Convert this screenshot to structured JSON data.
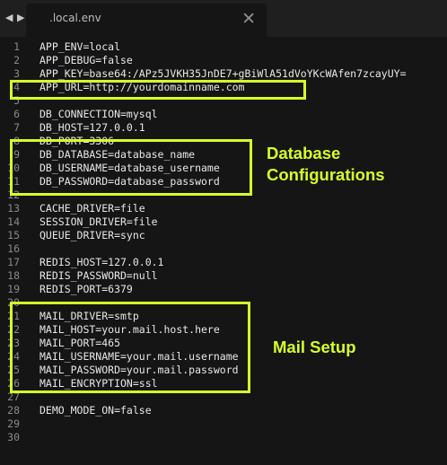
{
  "window": {
    "nav_back": "◀",
    "nav_forward": "▶",
    "tab_label": ".local.env",
    "tab_close": "✕"
  },
  "editor": {
    "lines": [
      {
        "n": "1",
        "text": "APP_ENV=local"
      },
      {
        "n": "2",
        "text": "APP_DEBUG=false"
      },
      {
        "n": "3",
        "text": "APP_KEY=base64:/APz5JVKH35JnDE7+gBiWlA51dVoYKcWAfen7zcayUY="
      },
      {
        "n": "4",
        "text": "APP_URL=http://yourdomainname.com"
      },
      {
        "n": "5",
        "text": ""
      },
      {
        "n": "6",
        "text": "DB_CONNECTION=mysql"
      },
      {
        "n": "7",
        "text": "DB_HOST=127.0.0.1"
      },
      {
        "n": "8",
        "text": "DB_PORT=3306"
      },
      {
        "n": "9",
        "text": "DB_DATABASE=database_name"
      },
      {
        "n": "10",
        "text": "DB_USERNAME=database_username"
      },
      {
        "n": "11",
        "text": "DB_PASSWORD=database_password"
      },
      {
        "n": "12",
        "text": ""
      },
      {
        "n": "13",
        "text": "CACHE_DRIVER=file"
      },
      {
        "n": "14",
        "text": "SESSION_DRIVER=file"
      },
      {
        "n": "15",
        "text": "QUEUE_DRIVER=sync"
      },
      {
        "n": "16",
        "text": ""
      },
      {
        "n": "17",
        "text": "REDIS_HOST=127.0.0.1"
      },
      {
        "n": "18",
        "text": "REDIS_PASSWORD=null"
      },
      {
        "n": "19",
        "text": "REDIS_PORT=6379"
      },
      {
        "n": "20",
        "text": ""
      },
      {
        "n": "21",
        "text": "MAIL_DRIVER=smtp"
      },
      {
        "n": "22",
        "text": "MAIL_HOST=your.mail.host.here"
      },
      {
        "n": "23",
        "text": "MAIL_PORT=465"
      },
      {
        "n": "24",
        "text": "MAIL_USERNAME=your.mail.username"
      },
      {
        "n": "25",
        "text": "MAIL_PASSWORD=your.mail.password"
      },
      {
        "n": "26",
        "text": "MAIL_ENCRYPTION=ssl"
      },
      {
        "n": "27",
        "text": ""
      },
      {
        "n": "28",
        "text": "DEMO_MODE_ON=false"
      },
      {
        "n": "29",
        "text": ""
      },
      {
        "n": "30",
        "text": ""
      }
    ]
  },
  "annotations": {
    "database_line1": "Database",
    "database_line2": "Configurations",
    "mail": "Mail Setup"
  },
  "colors": {
    "highlight": "#d6ff2a",
    "background": "#151515",
    "text": "#e8e8e8",
    "line_number": "#8a8a8a"
  }
}
